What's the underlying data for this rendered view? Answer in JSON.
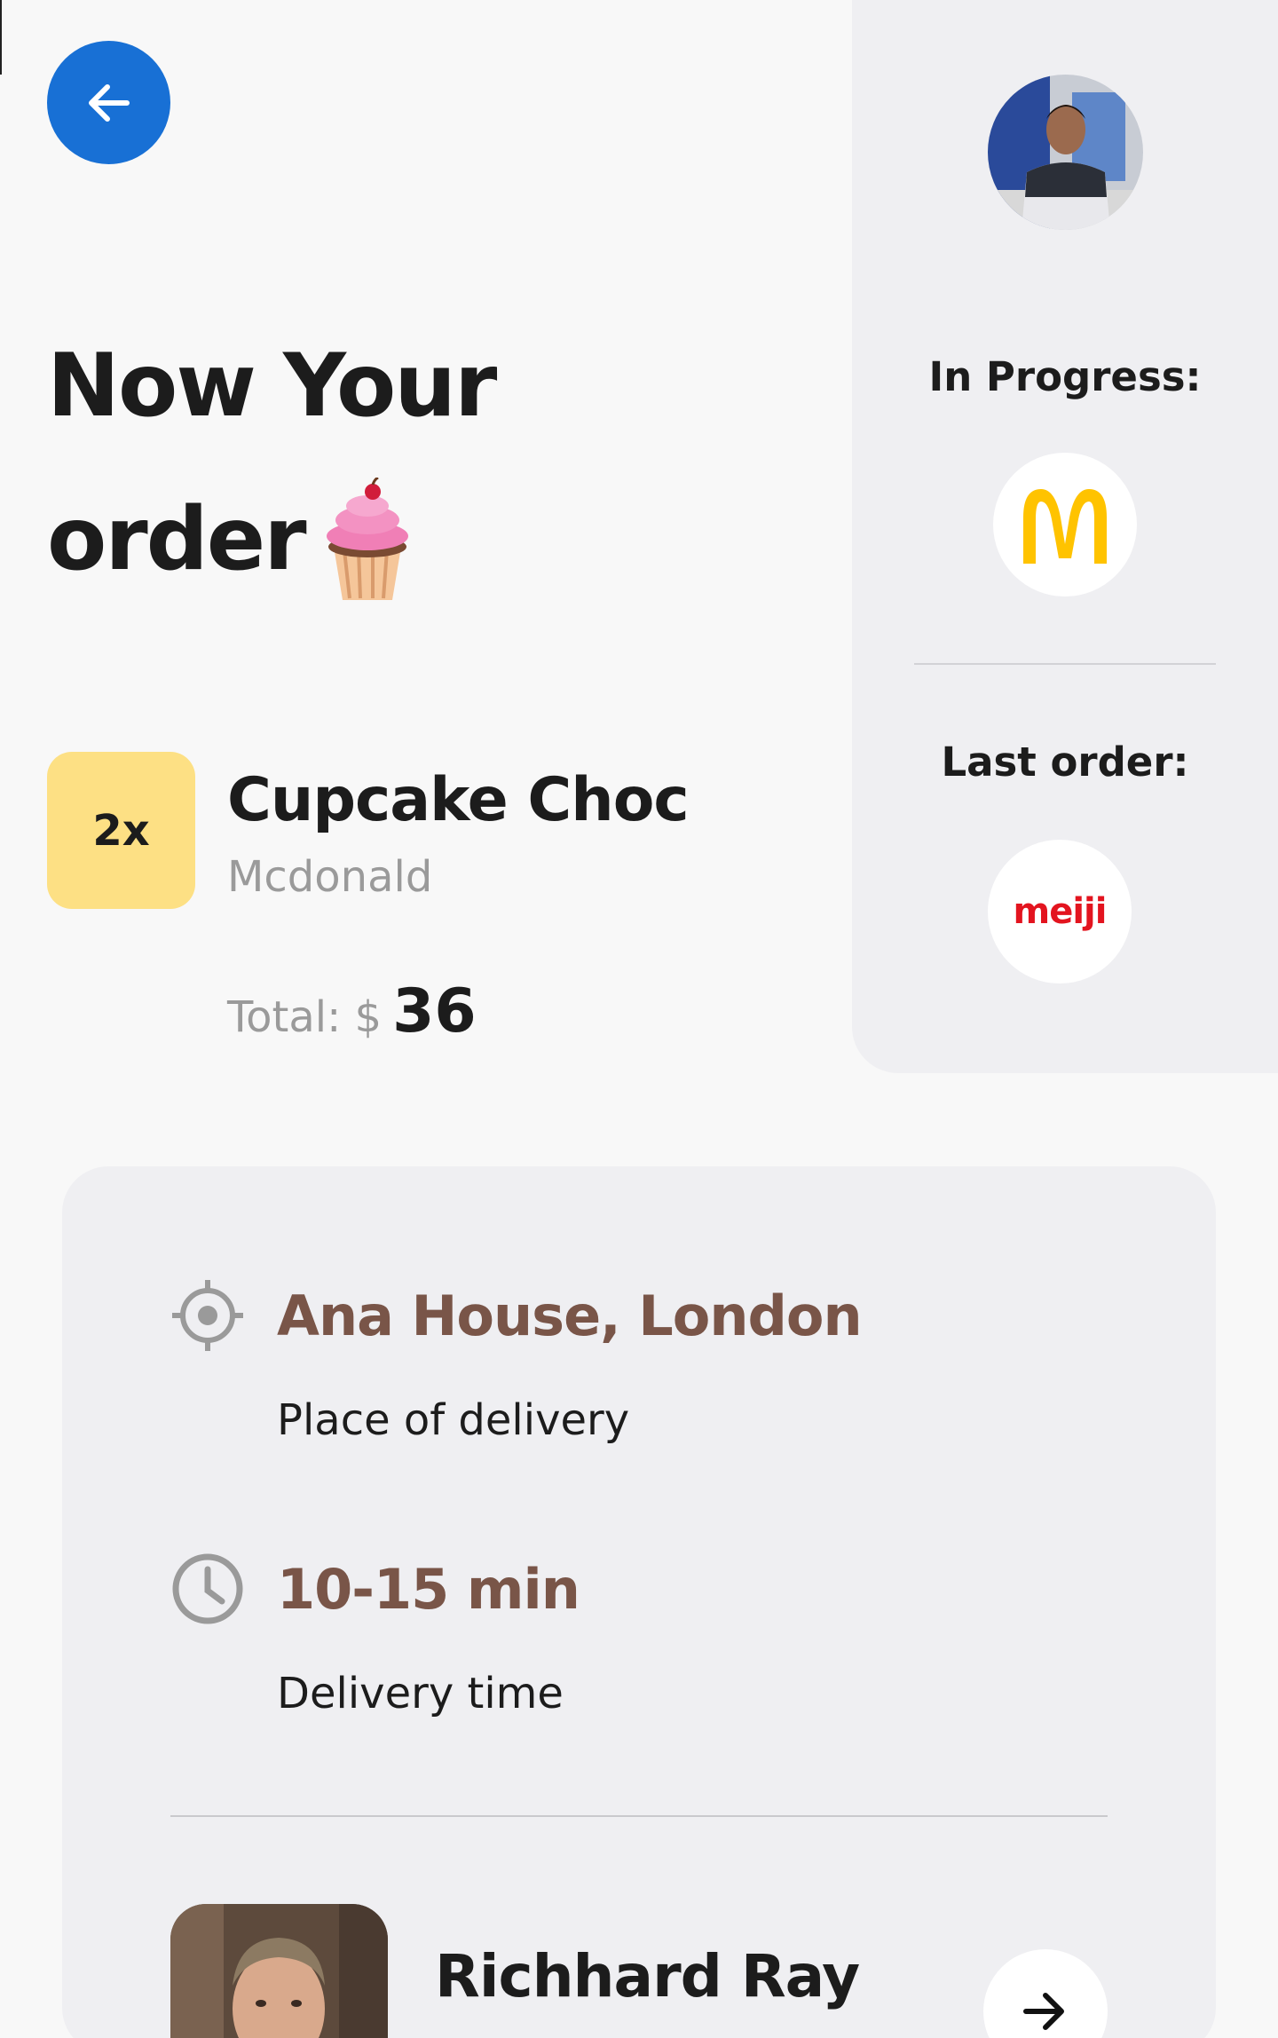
{
  "header": {
    "back_icon": "arrow-left-icon",
    "title_line1": "Now Your",
    "title_line2": "order",
    "title_emoji": "cupcake-icon"
  },
  "sidebar": {
    "in_progress_label": "In Progress:",
    "in_progress_brand": "Mcdonald",
    "last_order_label": "Last order:",
    "last_order_brand": "meiji"
  },
  "order": {
    "quantity": "2x",
    "item_name": "Cupcake Choc",
    "store": "Mcdonald",
    "total_label": "Total: $",
    "total_value": "36"
  },
  "delivery": {
    "place": "Ana House, London",
    "place_label": "Place of delivery",
    "time": "10-15 min",
    "time_label": "Delivery time"
  },
  "driver": {
    "name": "Richhard Ray",
    "action_icon": "arrow-right-icon"
  },
  "colors": {
    "primary": "#1870d5",
    "accent_brown": "#795548",
    "badge_yellow": "#fde084",
    "panel_gray": "#efeff2",
    "mcd_yellow": "#ffc300",
    "meiji_red": "#e3141f"
  }
}
